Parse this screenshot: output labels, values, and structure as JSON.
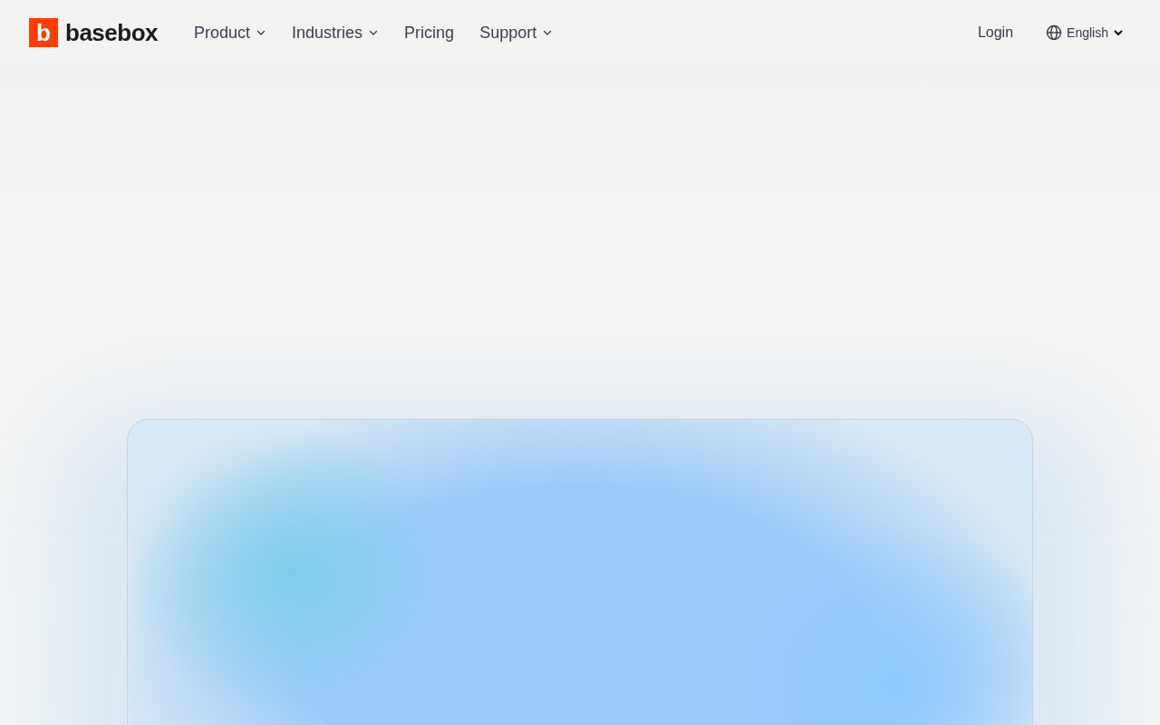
{
  "header": {
    "logo_mark": "b",
    "logo_text": "basebox",
    "nav": [
      {
        "label": "Product",
        "has_menu": true
      },
      {
        "label": "Industries",
        "has_menu": true
      },
      {
        "label": "Pricing",
        "has_menu": false
      },
      {
        "label": "Support",
        "has_menu": true
      }
    ],
    "login": "Login",
    "language": "English"
  }
}
